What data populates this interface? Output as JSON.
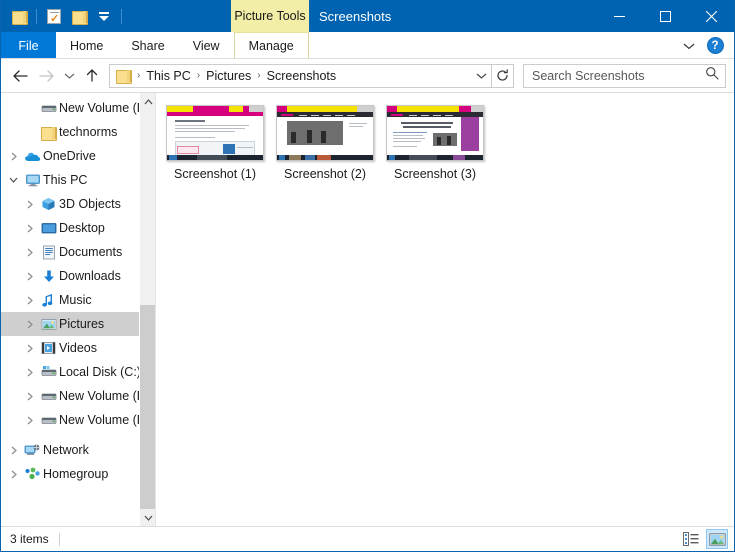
{
  "window": {
    "title": "Screenshots",
    "contextual_tab": "Picture Tools",
    "accent_color": "#0063b1",
    "controls": {
      "minimize": "Minimize",
      "maximize": "Maximize",
      "close": "Close"
    }
  },
  "quick_access": {
    "items": [
      {
        "name": "folder-icon",
        "label": "Folder"
      },
      {
        "name": "properties-icon",
        "label": "Properties"
      },
      {
        "name": "new-folder-icon",
        "label": "New folder"
      },
      {
        "name": "customize-chevron-icon",
        "label": "Customize Quick Access Toolbar"
      }
    ]
  },
  "ribbon": {
    "tabs": [
      {
        "label": "File",
        "active": true
      },
      {
        "label": "Home",
        "active": false
      },
      {
        "label": "Share",
        "active": false
      },
      {
        "label": "View",
        "active": false
      },
      {
        "label": "Manage",
        "active": false
      }
    ],
    "expand_label": "Expand the Ribbon",
    "help_label": "?"
  },
  "navigation": {
    "back": "Back",
    "forward": "Forward",
    "recent": "Recent locations",
    "up": "Up",
    "refresh": "Refresh",
    "breadcrumbs": [
      "This PC",
      "Pictures",
      "Screenshots"
    ],
    "separator": "›"
  },
  "search": {
    "placeholder": "Search Screenshots",
    "value": ""
  },
  "sidebar": {
    "items": [
      {
        "label": "New Volume (F:)",
        "depth": 1,
        "icon": "drive-icon",
        "expander": "",
        "selected": false
      },
      {
        "label": "technorms",
        "depth": 1,
        "icon": "folder-icon",
        "expander": "",
        "selected": false
      },
      {
        "label": "OneDrive",
        "depth": 0,
        "icon": "onedrive-icon",
        "expander": "collapsed",
        "selected": false
      },
      {
        "label": "This PC",
        "depth": 0,
        "icon": "thispc-icon",
        "expander": "expanded",
        "selected": false
      },
      {
        "label": "3D Objects",
        "depth": 1,
        "icon": "3dobjects-icon",
        "expander": "collapsed",
        "selected": false
      },
      {
        "label": "Desktop",
        "depth": 1,
        "icon": "desktop-icon",
        "expander": "collapsed",
        "selected": false
      },
      {
        "label": "Documents",
        "depth": 1,
        "icon": "documents-icon",
        "expander": "collapsed",
        "selected": false
      },
      {
        "label": "Downloads",
        "depth": 1,
        "icon": "downloads-icon",
        "expander": "collapsed",
        "selected": false
      },
      {
        "label": "Music",
        "depth": 1,
        "icon": "music-icon",
        "expander": "collapsed",
        "selected": false
      },
      {
        "label": "Pictures",
        "depth": 1,
        "icon": "pictures-icon",
        "expander": "collapsed",
        "selected": true
      },
      {
        "label": "Videos",
        "depth": 1,
        "icon": "videos-icon",
        "expander": "collapsed",
        "selected": false
      },
      {
        "label": "Local Disk (C:)",
        "depth": 1,
        "icon": "localdisk-icon",
        "expander": "collapsed",
        "selected": false
      },
      {
        "label": "New Volume (E:)",
        "depth": 1,
        "icon": "drive-icon",
        "expander": "collapsed",
        "selected": false
      },
      {
        "label": "New Volume (F:)",
        "depth": 1,
        "icon": "drive-icon",
        "expander": "collapsed",
        "selected": false
      },
      {
        "label": "Network",
        "depth": 0,
        "icon": "network-icon",
        "expander": "collapsed",
        "selected": false
      },
      {
        "label": "Homegroup",
        "depth": 0,
        "icon": "homegroup-icon",
        "expander": "collapsed",
        "selected": false
      }
    ],
    "scroll_up": "Scroll up",
    "scroll_down": "Scroll down"
  },
  "files": [
    {
      "name": "Screenshot (1)",
      "type": "image",
      "accent": "#d6007f"
    },
    {
      "name": "Screenshot (2)",
      "type": "image",
      "accent": "#f5e200"
    },
    {
      "name": "Screenshot (3)",
      "type": "image",
      "accent": "#9b3fa0"
    }
  ],
  "statusbar": {
    "item_count": "3 items",
    "views": [
      {
        "name": "details-view-button",
        "label": "Details view",
        "active": false
      },
      {
        "name": "large-icons-view-button",
        "label": "Large icons view",
        "active": true
      }
    ]
  }
}
